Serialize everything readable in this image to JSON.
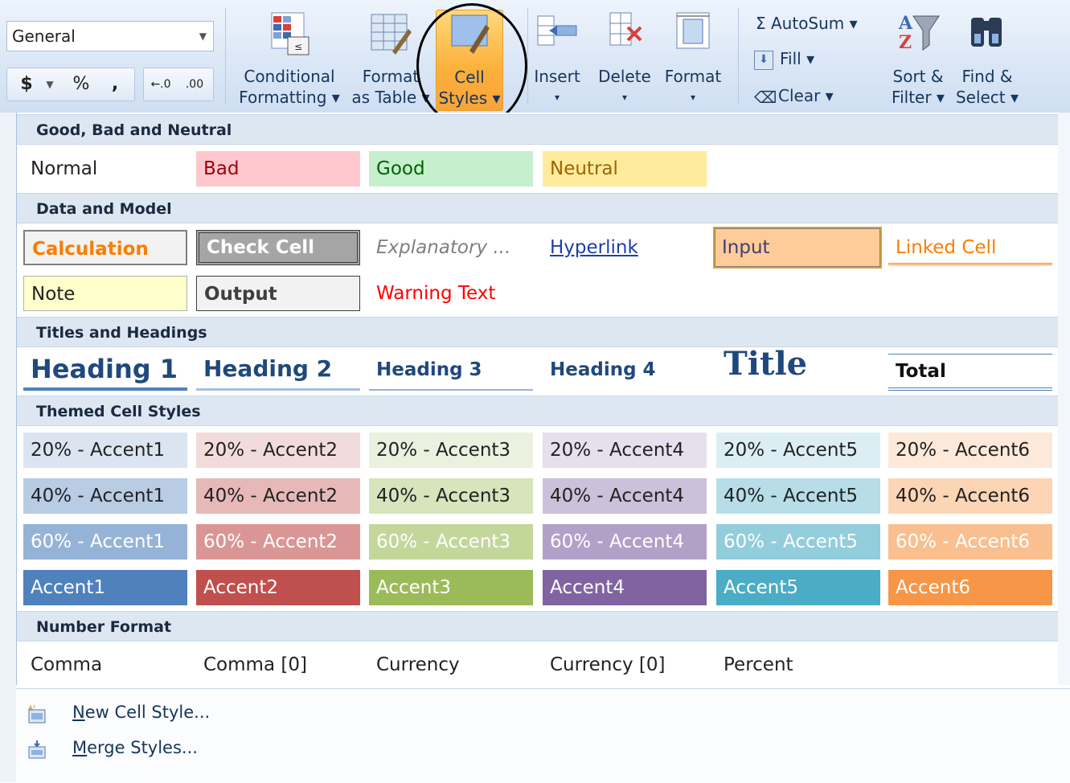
{
  "ribbon": {
    "number_format": "General",
    "number_buttons": [
      "$",
      "%",
      ",",
      "←.0",
      ".00"
    ],
    "buttons": {
      "conditional_formatting": [
        "Conditional",
        "Formatting ▾"
      ],
      "format_as_table": [
        "Format",
        "as Table ▾"
      ],
      "cell_styles": [
        "Cell",
        "Styles ▾"
      ],
      "insert": [
        "Insert",
        "▾"
      ],
      "delete": [
        "Delete",
        "▾"
      ],
      "format": [
        "Format",
        "▾"
      ],
      "sort_filter": [
        "Sort &",
        "Filter ▾"
      ],
      "find_select": [
        "Find &",
        "Select ▾"
      ]
    },
    "autosum": "Σ AutoSum ▾",
    "fill": "Fill ▾",
    "clear": "Clear ▾"
  },
  "gallery": {
    "sections": [
      "Good, Bad and Neutral",
      "Data and Model",
      "Titles and Headings",
      "Themed Cell Styles",
      "Number Format"
    ],
    "good_bad_neutral": [
      "Normal",
      "Bad",
      "Good",
      "Neutral"
    ],
    "data_model_row1": [
      "Calculation",
      "Check Cell",
      "Explanatory ...",
      "Hyperlink",
      "Input",
      "Linked Cell"
    ],
    "data_model_row2": [
      "Note",
      "Output",
      "Warning Text"
    ],
    "titles": [
      "Heading 1",
      "Heading 2",
      "Heading 3",
      "Heading 4",
      "Title",
      "Total"
    ],
    "themed_20": [
      "20% - Accent1",
      "20% - Accent2",
      "20% - Accent3",
      "20% - Accent4",
      "20% - Accent5",
      "20% - Accent6"
    ],
    "themed_40": [
      "40% - Accent1",
      "40% - Accent2",
      "40% - Accent3",
      "40% - Accent4",
      "40% - Accent5",
      "40% - Accent6"
    ],
    "themed_60": [
      "60% - Accent1",
      "60% - Accent2",
      "60% - Accent3",
      "60% - Accent4",
      "60% - Accent5",
      "60% - Accent6"
    ],
    "themed_accent": [
      "Accent1",
      "Accent2",
      "Accent3",
      "Accent4",
      "Accent5",
      "Accent6"
    ],
    "number_format": [
      "Comma",
      "Comma [0]",
      "Currency",
      "Currency [0]",
      "Percent"
    ]
  },
  "menu": {
    "new_cell_style": "New Cell Style...",
    "merge_styles": "Merge Styles..."
  },
  "colors": {
    "accent1": "#4f81bd",
    "accent2": "#c0504d",
    "accent3": "#9bbb59",
    "accent4": "#8064a2",
    "accent5": "#4bacc6",
    "accent6": "#f79646",
    "bad_fill": "#ffc7ce",
    "bad_text": "#9c0006",
    "good_fill": "#c6efce",
    "good_text": "#006100",
    "neutral_fill": "#ffeb9c",
    "neutral_text": "#9c6500"
  },
  "icons": [
    "conditional-formatting-icon",
    "format-table-icon",
    "cell-styles-icon",
    "insert-icon",
    "delete-icon",
    "format-icon",
    "autosum-icon",
    "fill-icon",
    "clear-icon",
    "sort-filter-icon",
    "find-select-icon",
    "new-style-icon",
    "merge-styles-icon"
  ]
}
